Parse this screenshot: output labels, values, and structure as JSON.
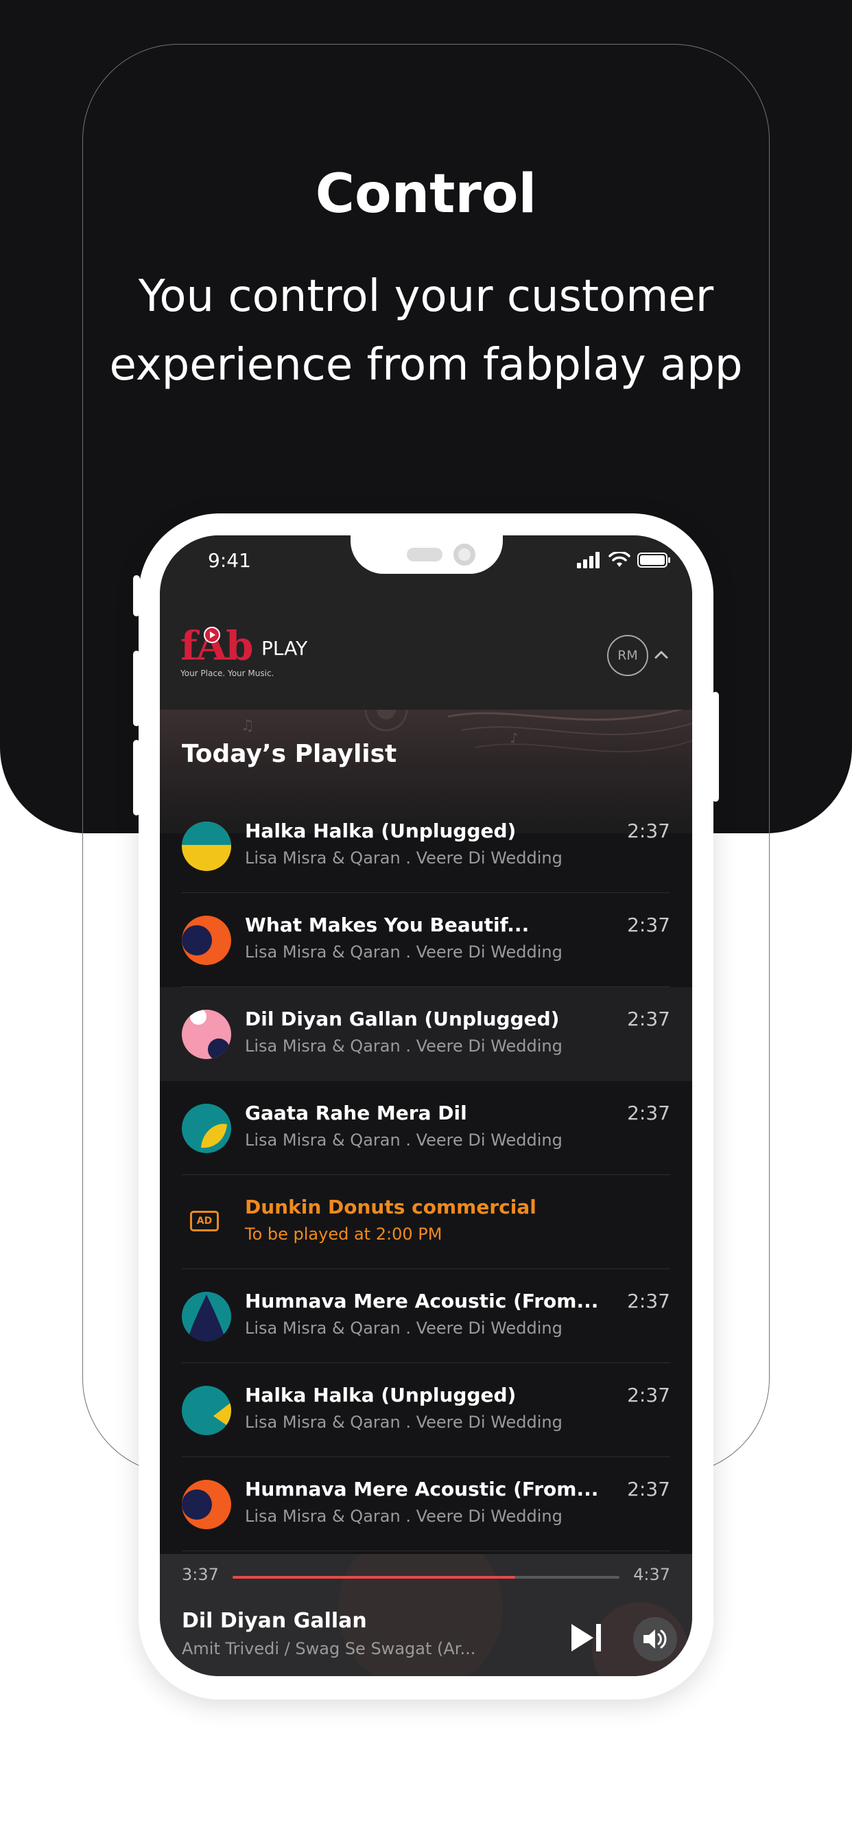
{
  "promo": {
    "headline": "Control",
    "subline_line1": "You control your customer",
    "subline_line2": "experience from fabplay app"
  },
  "status_bar": {
    "time": "9:41",
    "icons": [
      "signal-icon",
      "wifi-icon",
      "battery-icon"
    ]
  },
  "header": {
    "logo_mark": "fAb",
    "logo_play": "PLAY",
    "logo_tagline": "Your Place. Your Music.",
    "avatar_initials": "RM",
    "expand_icon": "chevron-up-icon"
  },
  "playlist": {
    "title": "Today’s Playlist",
    "rows": [
      {
        "type": "track",
        "title": "Halka Halka (Unplugged)",
        "subtitle": "Lisa Misra & Qaran  .  Veere Di Wedding",
        "duration": "2:37",
        "thumb": "teal-yellow"
      },
      {
        "type": "track",
        "title": "What Makes You Beautif...",
        "subtitle": "Lisa Misra & Qaran  .  Veere Di Wedding",
        "duration": "2:37",
        "thumb": "orange-navy"
      },
      {
        "type": "track",
        "title": "Dil Diyan Gallan (Unplugged)",
        "subtitle": "Lisa Misra & Qaran  .  Veere Di Wedding",
        "duration": "2:37",
        "thumb": "pink-navy",
        "active": true
      },
      {
        "type": "track",
        "title": "Gaata Rahe Mera Dil",
        "subtitle": "Lisa Misra & Qaran  .  Veere Di Wedding",
        "duration": "2:37",
        "thumb": "teal-leaf"
      },
      {
        "type": "ad",
        "title": "Dunkin Donuts commercial",
        "subtitle": "To be played at 2:00 PM",
        "icon_label": "AD"
      },
      {
        "type": "track",
        "title": "Humnava Mere Acoustic (From...",
        "subtitle": "Lisa Misra & Qaran  .  Veere Di Wedding",
        "duration": "2:37",
        "thumb": "teal-navy-arch"
      },
      {
        "type": "track",
        "title": "Halka Halka (Unplugged)",
        "subtitle": "Lisa Misra & Qaran  .  Veere Di Wedding",
        "duration": "2:37",
        "thumb": "teal-yellow-wedge"
      },
      {
        "type": "track",
        "title": "Humnava Mere Acoustic (From...",
        "subtitle": "Lisa Misra & Qaran  .  Veere Di Wedding",
        "duration": "2:37",
        "thumb": "orange-navy"
      }
    ]
  },
  "player": {
    "elapsed": "3:37",
    "total": "4:37",
    "progress_fraction": 0.73,
    "title": "Dil Diyan Gallan",
    "subtitle": "Amit Trivedi / Swag Se Swagat (Ar...",
    "next_icon": "skip-next-icon",
    "volume_icon": "volume-icon",
    "accent_color": "#e64a4a"
  },
  "colors": {
    "ad_accent": "#f08a1e",
    "brand_red": "#d41f3b"
  }
}
